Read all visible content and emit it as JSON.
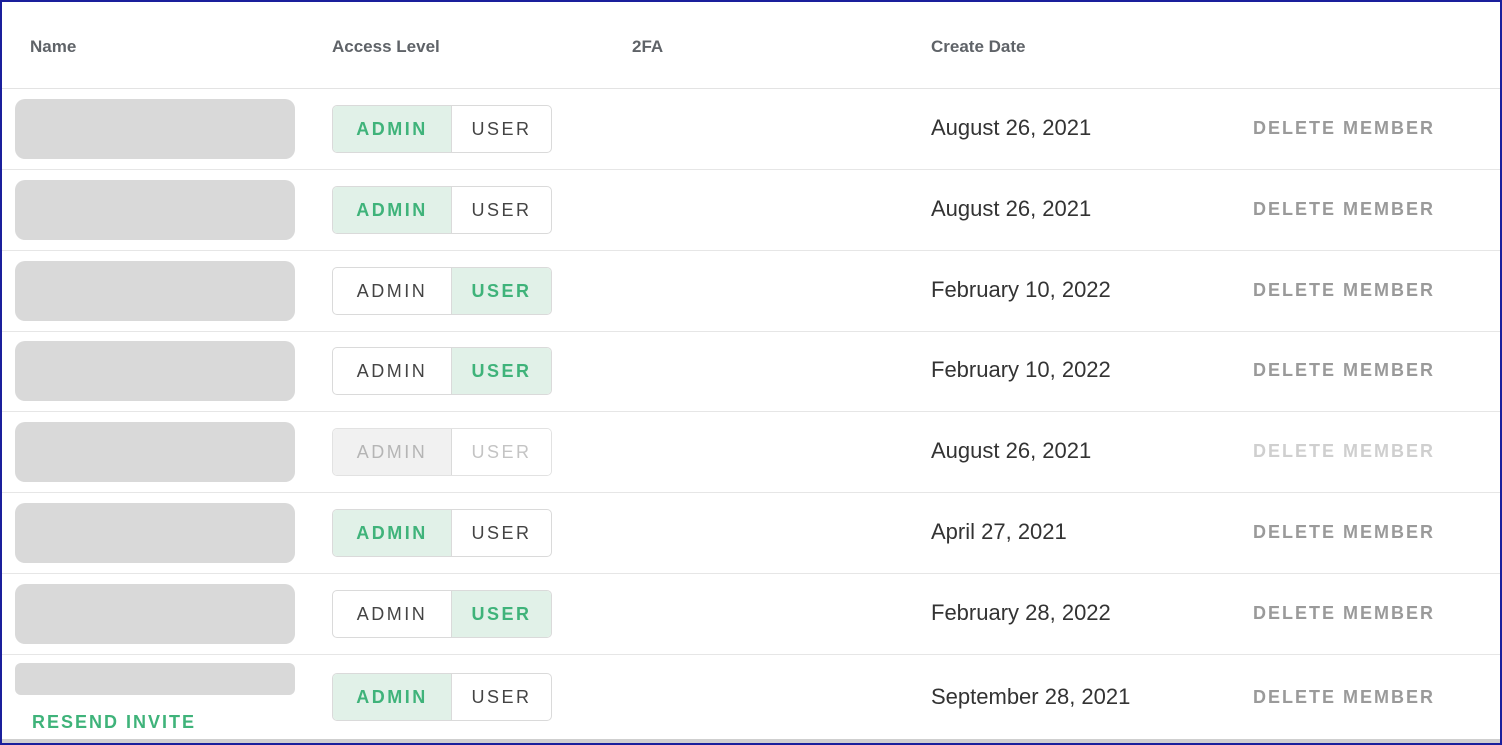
{
  "header": {
    "name": "Name",
    "access_level": "Access Level",
    "twofa": "2FA",
    "create_date": "Create Date"
  },
  "labels": {
    "admin": "ADMIN",
    "user": "USER",
    "delete": "DELETE MEMBER",
    "resend": "RESEND INVITE"
  },
  "members": [
    {
      "access": "admin",
      "create_date": "August 26, 2021",
      "disabled": false
    },
    {
      "access": "admin",
      "create_date": "August 26, 2021",
      "disabled": false
    },
    {
      "access": "user",
      "create_date": "February 10, 2022",
      "disabled": false
    },
    {
      "access": "user",
      "create_date": "February 10, 2022",
      "disabled": false
    },
    {
      "access": "admin",
      "create_date": "August 26, 2021",
      "disabled": true
    },
    {
      "access": "admin",
      "create_date": "April 27, 2021",
      "disabled": false
    },
    {
      "access": "user",
      "create_date": "February 28, 2022",
      "disabled": false
    },
    {
      "access": "admin",
      "create_date": "September 28, 2021",
      "disabled": false,
      "pending_invite": true
    }
  ],
  "colors": {
    "accent_green": "#3fb37a",
    "selected_bg": "#e1f1e8",
    "frame_border": "#1a1f9c"
  }
}
